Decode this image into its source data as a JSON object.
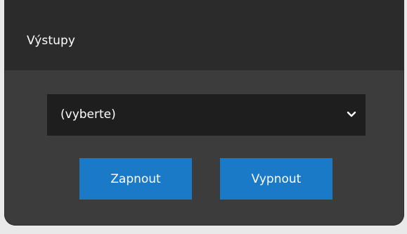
{
  "panel": {
    "title": "Výstupy"
  },
  "output_select": {
    "selected_value": "(vyberte)",
    "icon": "chevron-down-icon"
  },
  "actions": {
    "on_label": "Zapnout",
    "off_label": "Vypnout",
    "button_color": "#1a7ac8"
  }
}
